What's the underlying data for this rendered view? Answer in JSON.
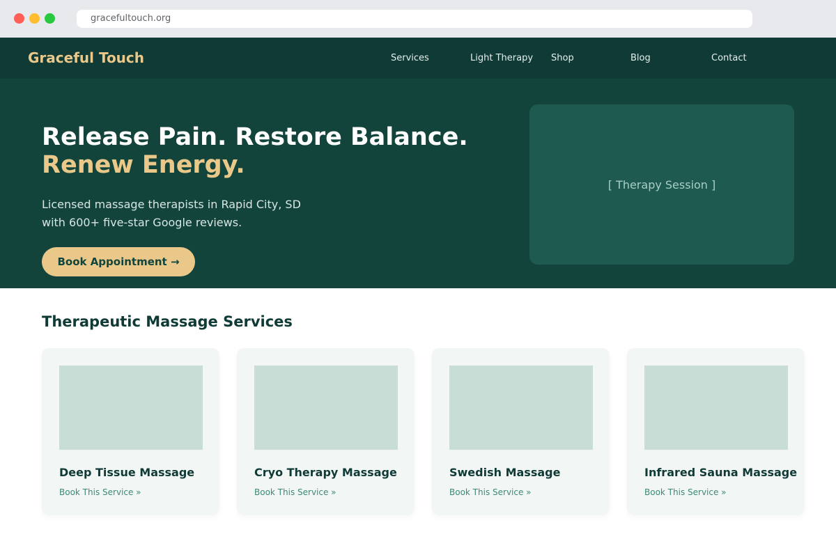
{
  "browser": {
    "url": "gracefultouch.org"
  },
  "nav": {
    "brand": "Graceful Touch",
    "links": [
      "Services",
      "Light Therapy",
      "Shop",
      "Blog",
      "Contact"
    ]
  },
  "hero": {
    "headline_line1": "Release Pain. Restore Balance.",
    "headline_line2": "Renew Energy.",
    "subtext_line1": "Licensed massage therapists in Rapid City, SD",
    "subtext_line2": "with 600+ five-star Google reviews.",
    "cta_label": "Book Appointment →",
    "image_placeholder": "[ Therapy Session ]"
  },
  "services": {
    "title": "Therapeutic Massage Services",
    "cards": [
      {
        "name": "Deep Tissue Massage",
        "link": "Book This Service »"
      },
      {
        "name": "Cryo Therapy Massage",
        "link": "Book This Service »"
      },
      {
        "name": "Swedish Massage",
        "link": "Book This Service »"
      },
      {
        "name": "Infrared Sauna Massage",
        "link": "Book This Service »"
      }
    ]
  },
  "colors": {
    "nav_bg": "#0f3a35",
    "hero_bg": "#13443c",
    "accent": "#e9c889",
    "card_bg": "#f2f6f5",
    "link": "#3a8a78"
  }
}
